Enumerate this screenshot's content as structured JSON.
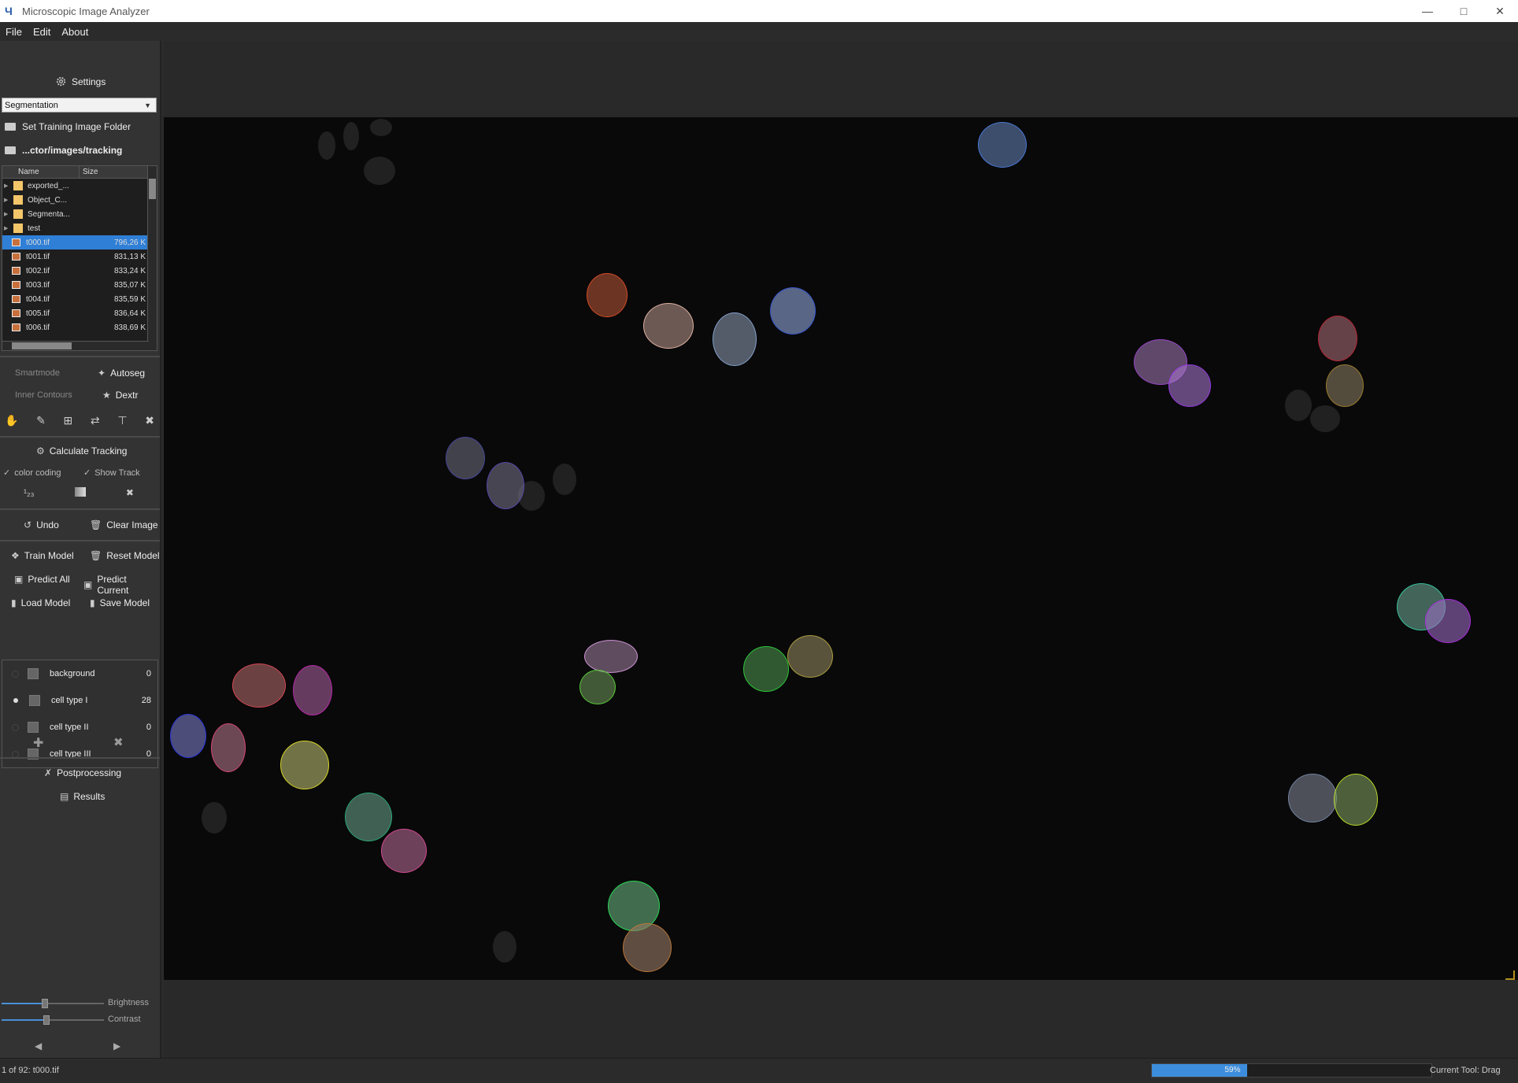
{
  "window": {
    "title": "Microscopic Image Analyzer",
    "app_icon": "microscope-app-icon",
    "controls": [
      "minimize-icon",
      "maximize-icon",
      "close-icon"
    ]
  },
  "menu": {
    "items": [
      "File",
      "Edit",
      "About"
    ]
  },
  "sidebar": {
    "settings_label": "Settings",
    "mode_select": "Segmentation",
    "set_training_folder": "Set Training Image Folder",
    "current_folder": "...ctor/images/tracking",
    "file_tree": {
      "columns": [
        "Name",
        "Size"
      ],
      "folders": [
        "exported_...",
        "Object_C...",
        "Segmenta...",
        "test"
      ],
      "files": [
        {
          "name": "t000.tif",
          "size": "796,26 K",
          "selected": true
        },
        {
          "name": "t001.tif",
          "size": "831,13 K"
        },
        {
          "name": "t002.tif",
          "size": "833,24 K"
        },
        {
          "name": "t003.tif",
          "size": "835,07 K"
        },
        {
          "name": "t004.tif",
          "size": "835,59 K"
        },
        {
          "name": "t005.tif",
          "size": "836,64 K"
        },
        {
          "name": "t006.tif",
          "size": "838,69 K"
        }
      ]
    },
    "smartmode_label": "Smartmode",
    "autoseg_label": "Autoseg",
    "inner_contours_label": "Inner Contours",
    "dextr_label": "Dextr",
    "tools": [
      "hand-icon",
      "pen-icon",
      "crop-icon",
      "shuffle-icon",
      "stamp-icon",
      "delete-icon"
    ],
    "calc_tracking_label": "Calculate Tracking",
    "color_coding_label": "color coding",
    "show_track_label": "Show Track",
    "undo_label": "Undo",
    "clear_image_label": "Clear Image",
    "train_model_label": "Train Model",
    "reset_model_label": "Reset Model",
    "predict_all_label": "Predict All",
    "predict_current_label": "Predict Current",
    "load_model_label": "Load Model",
    "save_model_label": "Save Model",
    "classes": [
      {
        "name": "background",
        "count": "0",
        "selected": false
      },
      {
        "name": "cell type I",
        "count": "28",
        "selected": true
      },
      {
        "name": "cell type II",
        "count": "0",
        "selected": false
      },
      {
        "name": "cell type III",
        "count": "0",
        "selected": false
      }
    ],
    "postprocessing_label": "Postprocessing",
    "results_label": "Results",
    "brightness_label": "Brightness",
    "contrast_label": "Contrast",
    "brightness_value": 0.42,
    "contrast_value": 0.44
  },
  "status": {
    "image_info": "1 of 92: t000.tif",
    "progress_text": "59%",
    "progress_value": 0.59,
    "current_tool": "Current Tool: Drag"
  }
}
